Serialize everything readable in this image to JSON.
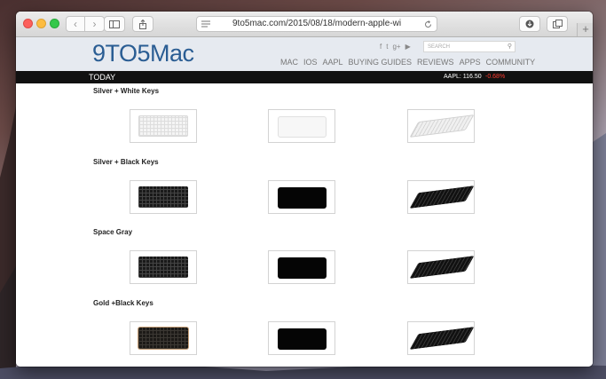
{
  "browser": {
    "url": "9to5mac.com/2015/08/18/modern-apple-wi",
    "new_tab_label": "+"
  },
  "site": {
    "logo": "9TO5Mac",
    "search_placeholder": "SEARCH",
    "social_icons": [
      "facebook-icon",
      "twitter-icon",
      "google-plus-icon",
      "youtube-icon"
    ],
    "nav": [
      "MAC",
      "IOS",
      "AAPL",
      "BUYING GUIDES",
      "REVIEWS",
      "APPS",
      "COMMUNITY"
    ],
    "today_label": "TODAY",
    "ticker": "AAPL: 116.50",
    "ticker_change": "-0.68%",
    "brand_color": "#2a5d93",
    "change_color": "#ff3b30"
  },
  "sections": [
    {
      "title": "Silver + White Keys",
      "variant": "white"
    },
    {
      "title": "Silver + Black Keys",
      "variant": "black"
    },
    {
      "title": "Space Gray",
      "variant": "black"
    },
    {
      "title": "Gold +Black Keys",
      "variant": "gold"
    }
  ]
}
